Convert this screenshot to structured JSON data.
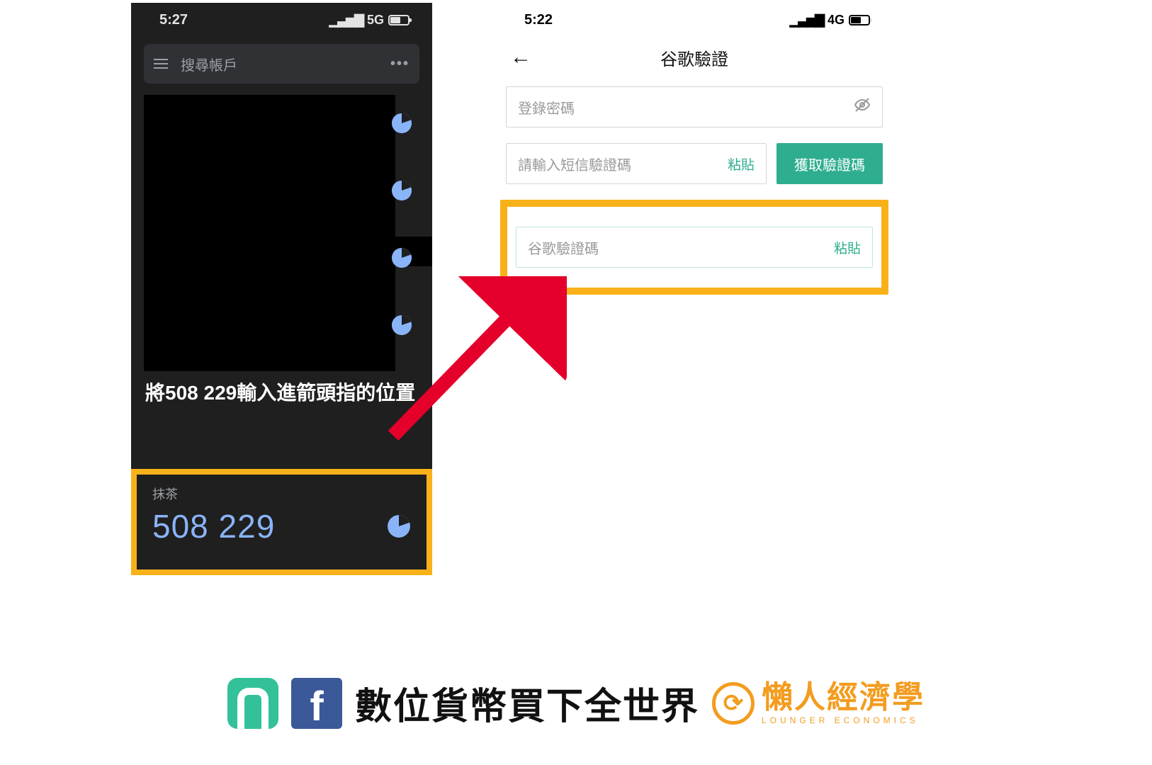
{
  "left": {
    "status": {
      "time": "5:27",
      "net": "5G"
    },
    "search_placeholder": "搜尋帳戶",
    "instruction": "將508 229輸入進箭頭指的位置",
    "account_label": "抹茶",
    "code": "508 229"
  },
  "right": {
    "status": {
      "time": "5:22",
      "net": "4G"
    },
    "title": "谷歌驗證",
    "password_placeholder": "登錄密碼",
    "sms_placeholder": "請輸入短信驗證碼",
    "paste_label": "粘貼",
    "get_code_label": "獲取驗證碼",
    "ga_placeholder": "谷歌驗證碼"
  },
  "footer": {
    "main": "數位貨幣買下全世界",
    "brand_cn": "懶人經濟學",
    "brand_en": "LOUNGER ECONOMICS"
  }
}
